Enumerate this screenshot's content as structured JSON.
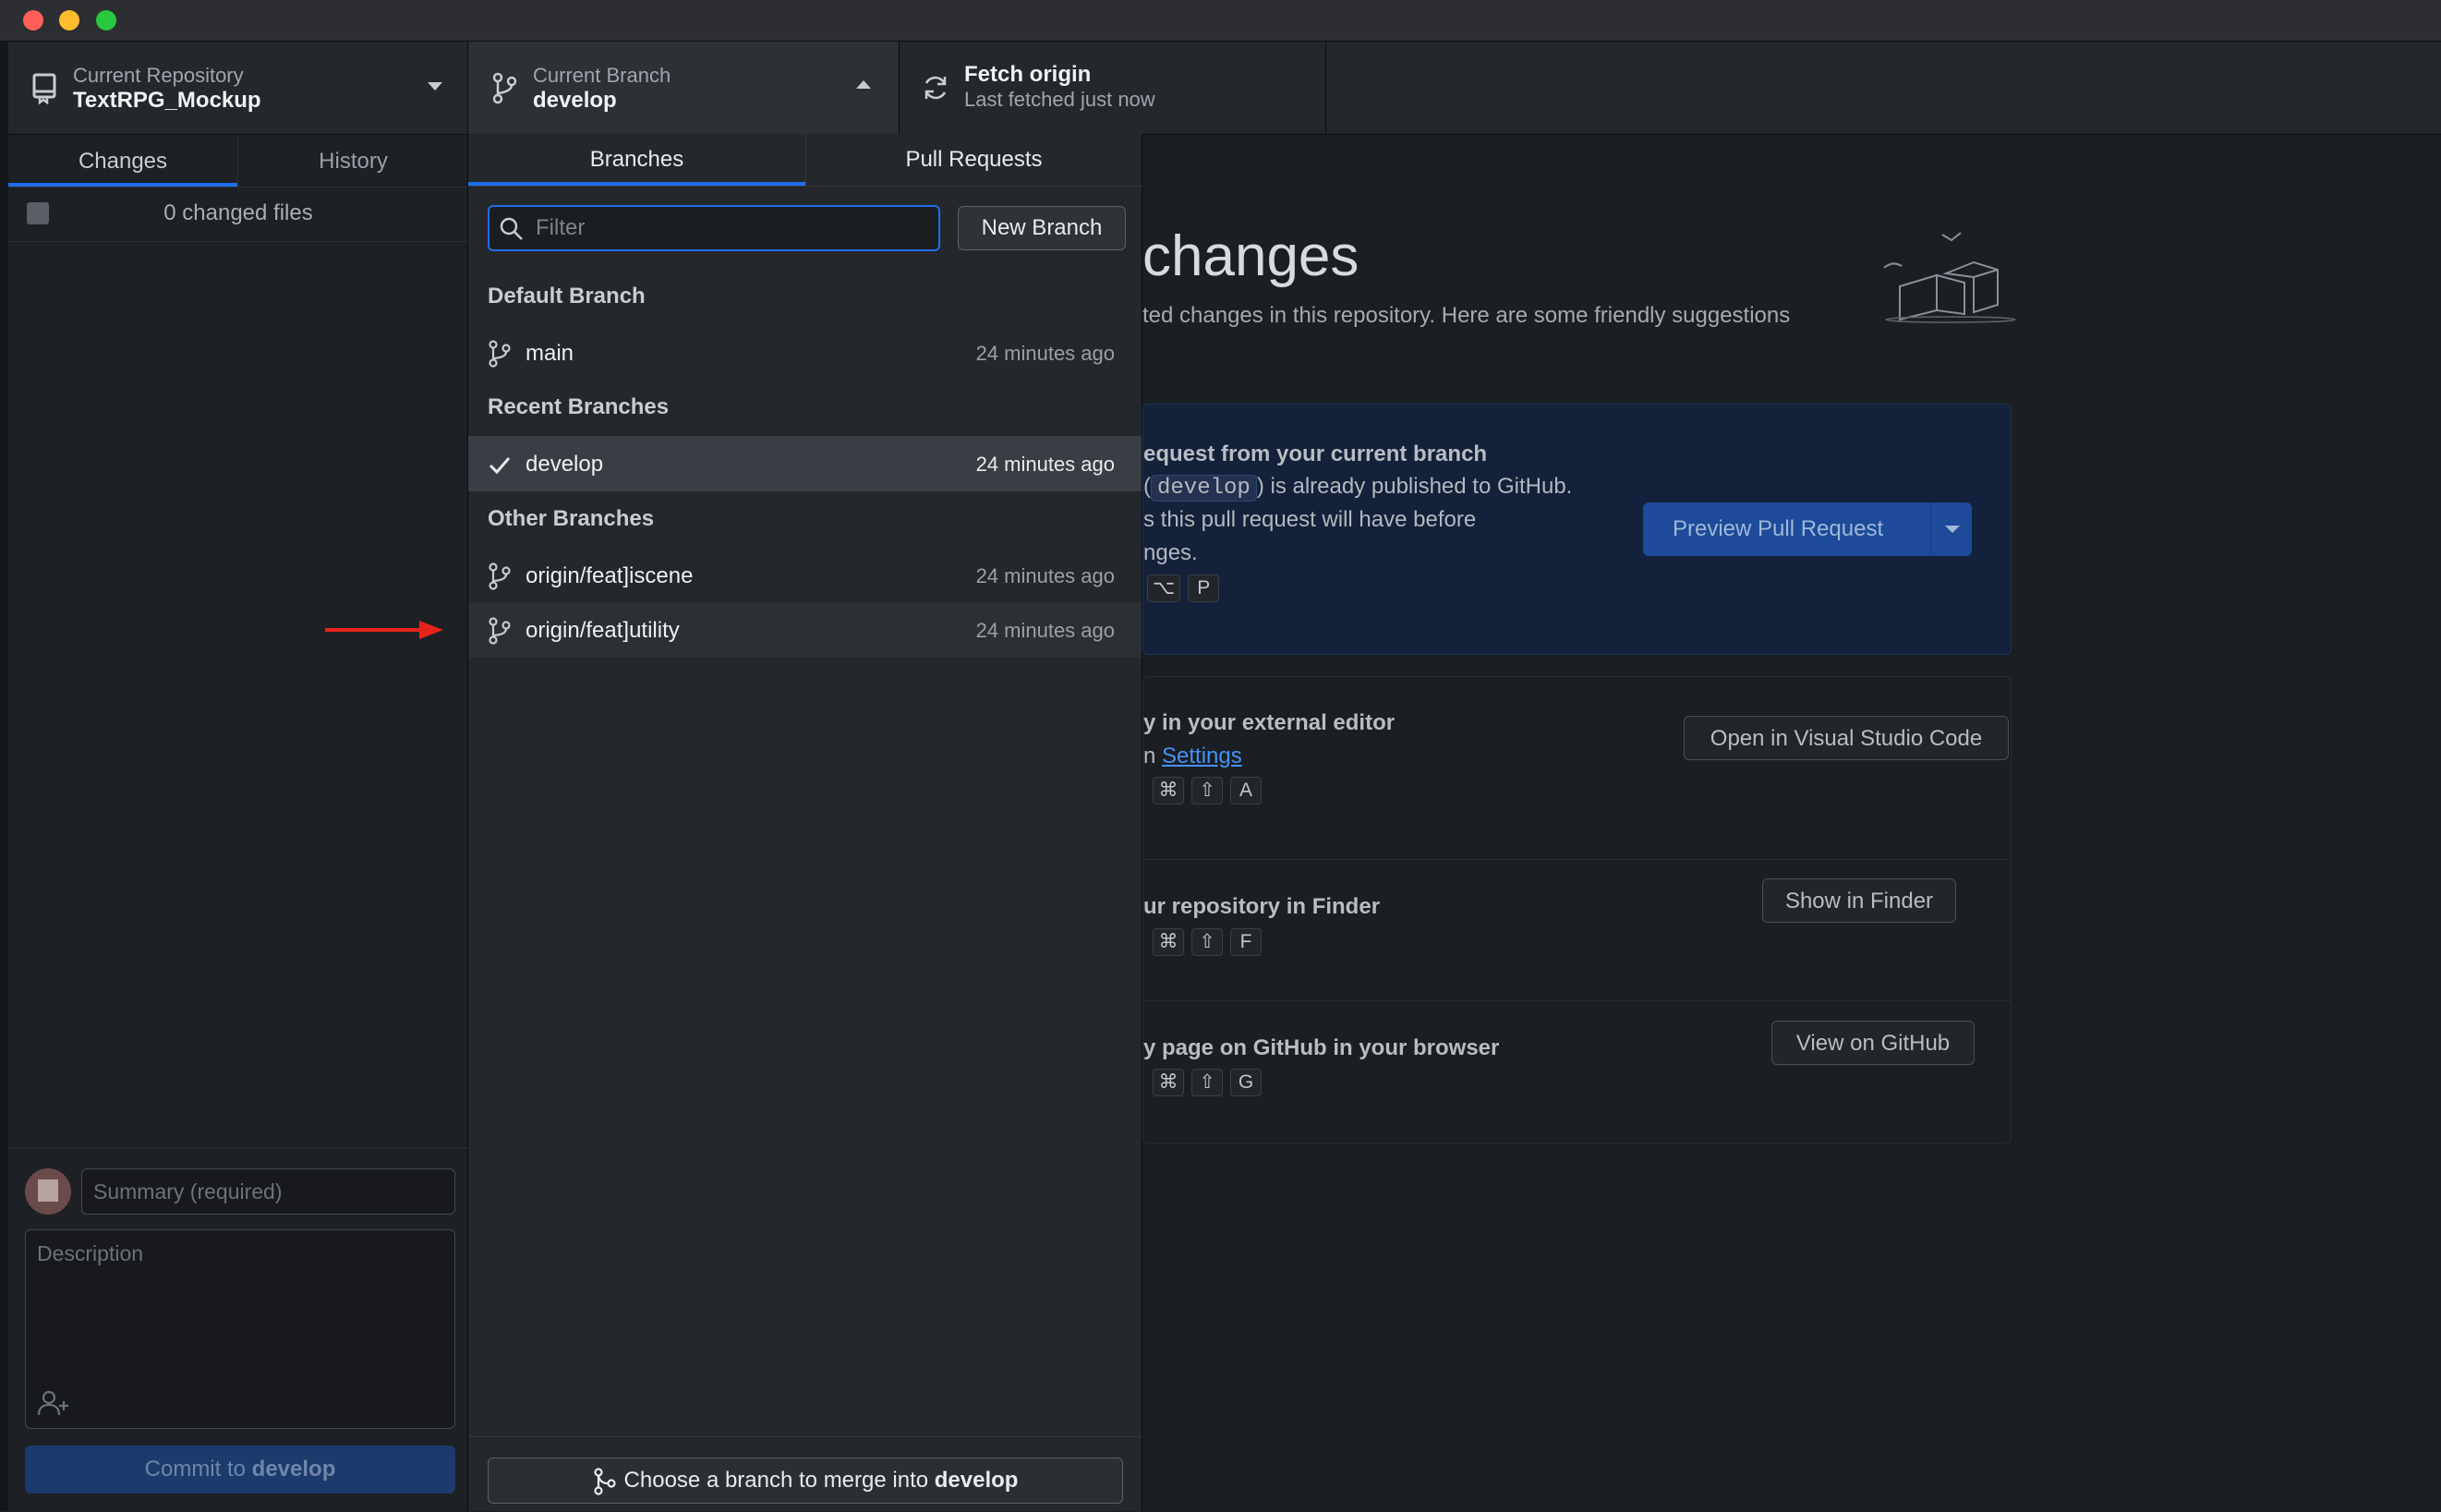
{
  "toolbar": {
    "repo": {
      "label": "Current Repository",
      "value": "TextRPG_Mockup"
    },
    "branch": {
      "label": "Current Branch",
      "value": "develop"
    },
    "fetch": {
      "label": "Fetch origin",
      "value": "Last fetched just now"
    }
  },
  "sidebar": {
    "tabs": [
      {
        "label": "Changes"
      },
      {
        "label": "History"
      }
    ],
    "changed_files": "0 changed files",
    "summary_placeholder": "Summary (required)",
    "description_placeholder": "Description",
    "commit_prefix": "Commit to ",
    "commit_branch": "develop"
  },
  "dropdown": {
    "tabs": [
      {
        "label": "Branches"
      },
      {
        "label": "Pull Requests"
      }
    ],
    "filter_placeholder": "Filter",
    "new_branch": "New Branch",
    "sections": {
      "default": "Default Branch",
      "recent": "Recent Branches",
      "other": "Other Branches"
    },
    "branches": {
      "main": {
        "name": "main",
        "time": "24 minutes ago"
      },
      "develop": {
        "name": "develop",
        "time": "24 minutes ago"
      },
      "feat_scene": {
        "name": "origin/feat]iscene",
        "time": "24 minutes ago"
      },
      "feat_utility": {
        "name": "origin/feat]utility",
        "time": "24 minutes ago"
      }
    },
    "merge_prefix": "Choose a branch to merge into ",
    "merge_branch": "develop"
  },
  "main": {
    "title": "changes",
    "subtitle": "ted changes in this repository. Here are some friendly suggestions",
    "pr_card": {
      "title": "equest from your current branch",
      "code_open": "(",
      "code": "develop",
      "line1_rest": ") is already published to GitHub.",
      "line2": "s this pull request will have before",
      "line3": "nges.",
      "keys": [
        "⌥",
        "P"
      ],
      "button": "Preview Pull Request"
    },
    "editor_card": {
      "title": "y in your external editor",
      "line_prefix": "n ",
      "link": "Settings",
      "keys": [
        "⌘",
        "⇧",
        "A"
      ],
      "button": "Open in Visual Studio Code"
    },
    "finder_card": {
      "title": "ur repository in Finder",
      "keys": [
        "⌘",
        "⇧",
        "F"
      ],
      "button": "Show in Finder"
    },
    "github_card": {
      "title": "y page on GitHub in your browser",
      "keys": [
        "⌘",
        "⇧",
        "G"
      ],
      "button": "View on GitHub"
    }
  },
  "colors": {
    "accent": "#1f6feb",
    "annotation_arrow": "#e8231a"
  }
}
